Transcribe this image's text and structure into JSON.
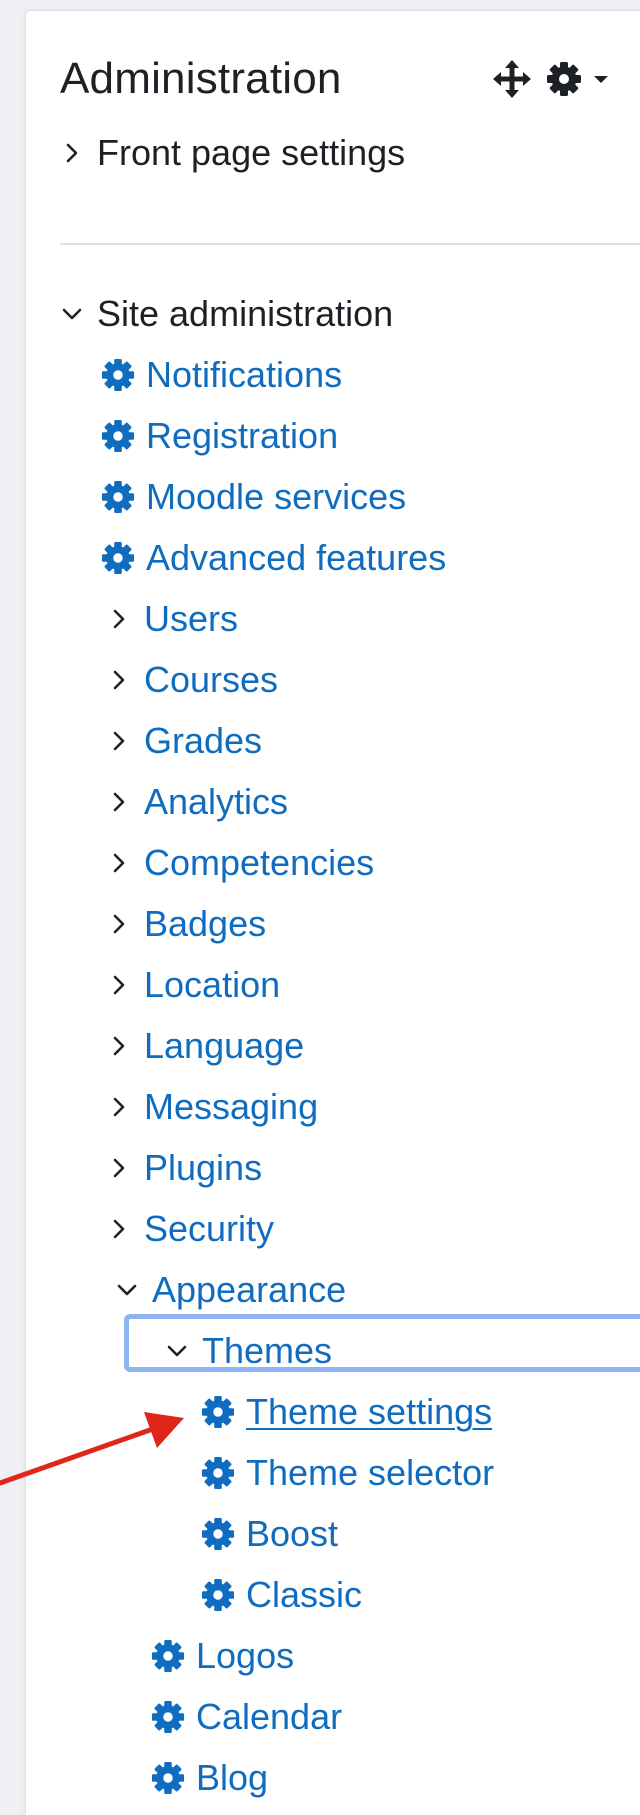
{
  "block": {
    "title": "Administration"
  },
  "front_page": {
    "label": "Front page settings"
  },
  "site_admin": {
    "label": "Site administration"
  },
  "settings_items": {
    "notifications": "Notifications",
    "registration": "Registration",
    "moodle_services": "Moodle services",
    "advanced_features": "Advanced features"
  },
  "categories": {
    "users": "Users",
    "courses": "Courses",
    "grades": "Grades",
    "analytics": "Analytics",
    "competencies": "Competencies",
    "badges": "Badges",
    "location": "Location",
    "language": "Language",
    "messaging": "Messaging",
    "plugins": "Plugins",
    "security": "Security",
    "appearance": "Appearance"
  },
  "appearance": {
    "themes": "Themes",
    "theme_items": {
      "theme_settings": "Theme settings",
      "theme_selector": "Theme selector",
      "boost": "Boost",
      "classic": "Classic"
    },
    "logos": "Logos",
    "calendar": "Calendar",
    "blog": "Blog"
  },
  "colors": {
    "link": "#0f6cbf",
    "text": "#1d2125",
    "focus": "#8fb4f2",
    "arrow": "#e0261a"
  },
  "icons": {
    "header": [
      "move-icon",
      "gear-icon",
      "caret-down-icon"
    ],
    "collapsed": "chevron-right-icon",
    "expanded": "chevron-down-icon",
    "setting": "cog-icon"
  }
}
